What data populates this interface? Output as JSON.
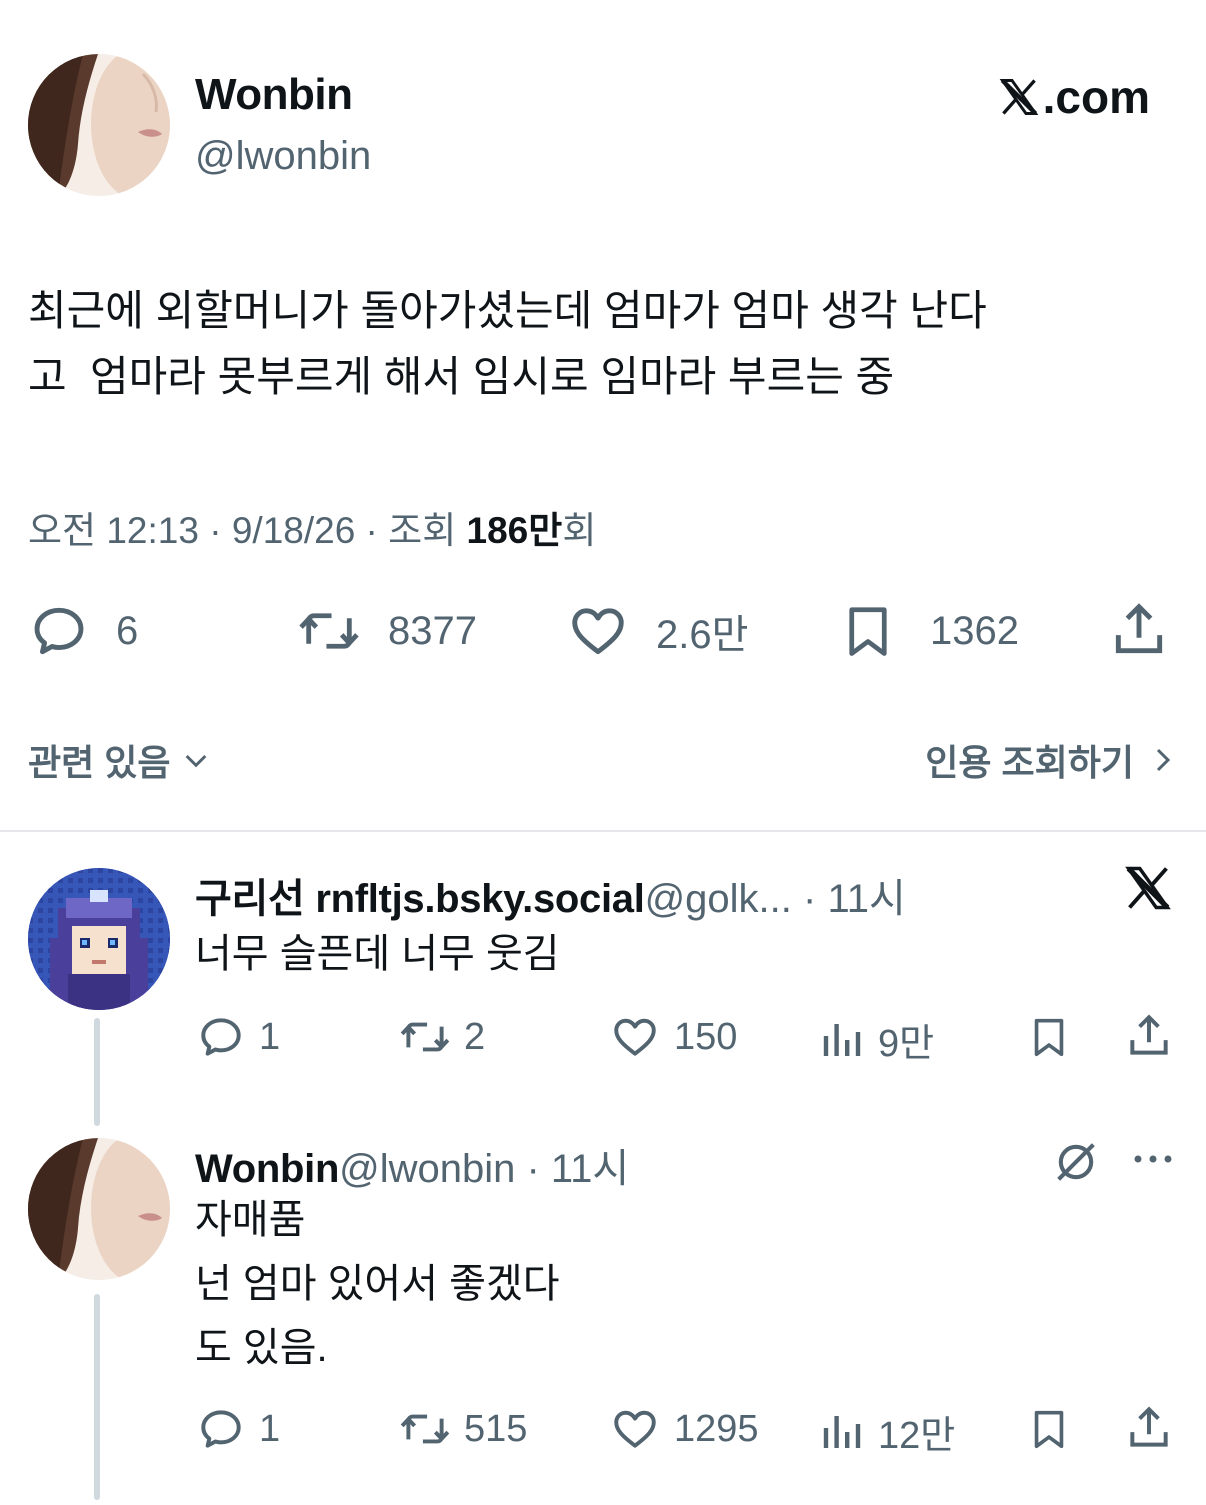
{
  "main_tweet": {
    "author_name": "Wonbin",
    "author_handle": "@lwonbin",
    "brand_text": ".com",
    "text": "최근에 외할머니가 돌아가셨는데 엄마가 엄마 생각 난다\n고  엄마라 못부르게 해서 임시로 임마라 부르는 중",
    "meta_time": "오전 12:13 · 9/18/26 · 조회 ",
    "meta_views_bold": "186만",
    "meta_views_suffix": "회",
    "actions": {
      "replies": "6",
      "retweets": "8377",
      "likes": "2.6만",
      "bookmarks": "1362"
    },
    "related_label": "관련 있음",
    "quotes_label": "인용 조회하기"
  },
  "replies": [
    {
      "author_name": "구리선 rnfltjs.bsky.social",
      "author_handle": "@golk...",
      "time": " · 11시",
      "text": "너무 슬픈데 너무 웃김",
      "actions": {
        "replies": "1",
        "retweets": "2",
        "likes": "150",
        "views": "9만"
      }
    },
    {
      "author_name": "Wonbin",
      "author_handle": "@lwonbin",
      "time": " · 11시",
      "text": "자매품\n넌 엄마 있어서 좋겠다\n도 있음.",
      "actions": {
        "replies": "1",
        "retweets": "515",
        "likes": "1295",
        "views": "12만"
      }
    }
  ],
  "colors": {
    "text_primary": "#0f1419",
    "text_secondary": "#536471",
    "divider": "#e5e7ea",
    "thread_line": "#cfd9de"
  }
}
